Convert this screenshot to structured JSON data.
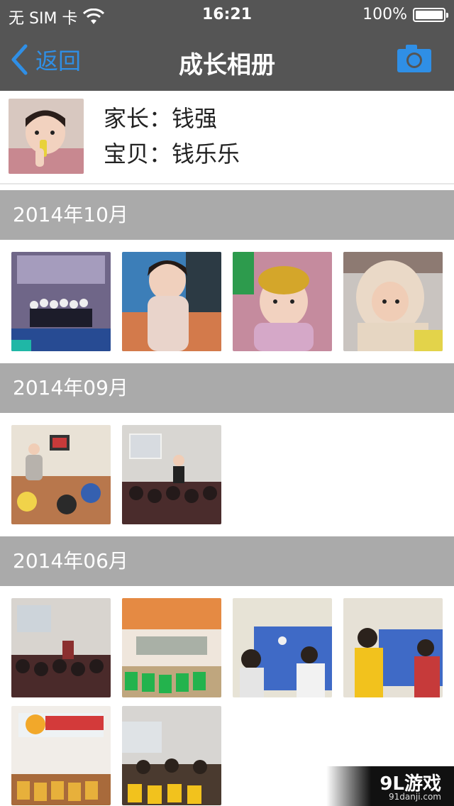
{
  "status": {
    "carrier": "无 SIM 卡",
    "time": "16:21",
    "battery": "100%",
    "battery_level": 1.0
  },
  "nav": {
    "back_label": "返回",
    "title": "成长相册",
    "camera_icon": "camera-icon"
  },
  "profile": {
    "parent_label": "家长：",
    "parent_name": "钱强",
    "baby_label": "宝贝：",
    "baby_name": "钱乐乐"
  },
  "sections": [
    {
      "label": "2014年10月"
    },
    {
      "label": "2014年09月"
    },
    {
      "label": "2014年06月"
    }
  ],
  "colors": {
    "nav_bg": "#555555",
    "accent": "#2f8fe6",
    "section_bg": "#aaaaaa"
  },
  "watermark": {
    "brand": "9L游戏",
    "site": "91danji.com"
  }
}
